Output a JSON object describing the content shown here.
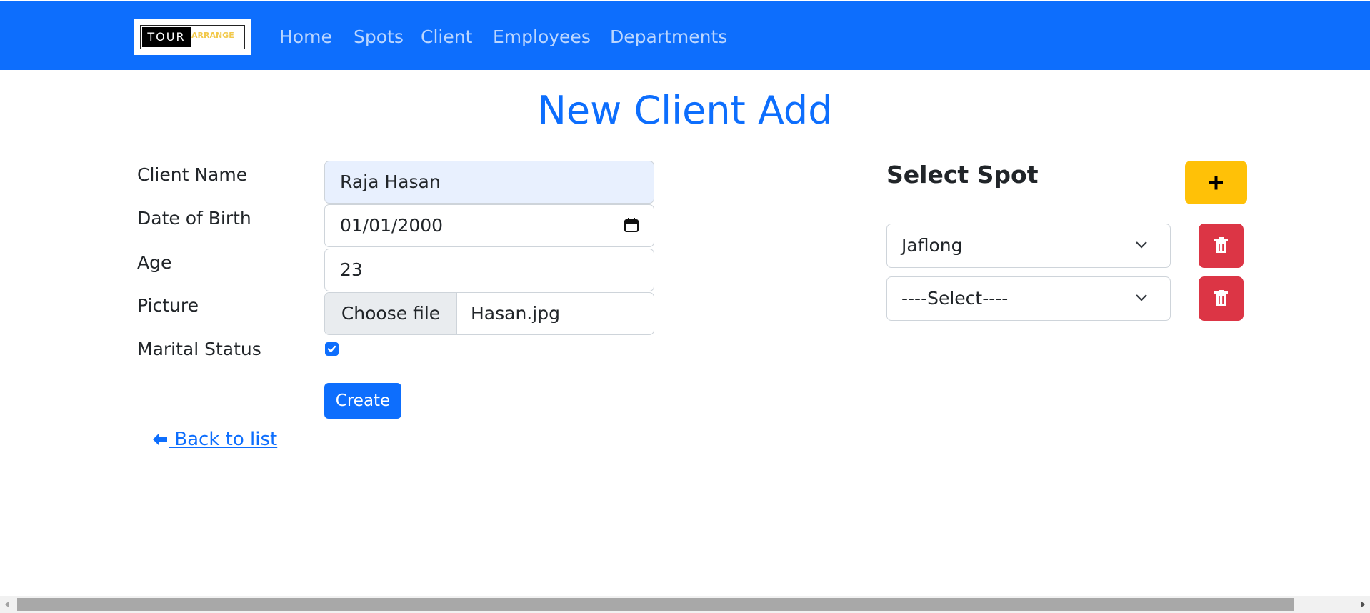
{
  "navbar": {
    "logo_left": "TOUR",
    "logo_right": "ARRANGE",
    "links": [
      "Home",
      "Spots",
      "Client",
      "Employees",
      "Departments"
    ]
  },
  "page_title": "New Client Add",
  "form": {
    "client_name_label": "Client Name",
    "client_name_value": "Raja Hasan",
    "dob_label": "Date of Birth",
    "dob_value": "01/01/2000",
    "age_label": "Age",
    "age_value": "23",
    "picture_label": "Picture",
    "choose_file_label": "Choose file",
    "file_name": "Hasan.jpg",
    "marital_label": "Marital Status",
    "marital_checked": true,
    "create_label": "Create"
  },
  "back_link": " Back to list",
  "spots": {
    "title": "Select Spot",
    "add_icon": "plus-icon",
    "selected": [
      "Jaflong",
      "----Select----"
    ],
    "delete_icon": "trash-icon"
  },
  "colors": {
    "primary": "#0d6efd",
    "warning": "#ffc107",
    "danger": "#dc3545"
  }
}
